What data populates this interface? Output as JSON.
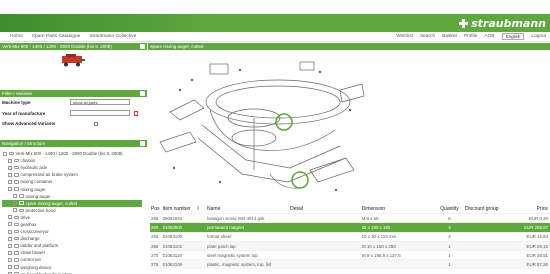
{
  "header": {
    "brand": "straubmann",
    "menu_left": [
      "Home",
      "Spare Parts Catalogue",
      "Strautmann Collective"
    ],
    "menu_right": [
      "Wishlist",
      "Search",
      "Basket",
      "Profile",
      "AGB"
    ],
    "language": "English",
    "logout": "Logout"
  },
  "left_panel": {
    "machine_title": "Verti-Mix 600 - 1400 / 1200 - 2800 Double (bis 8, 2008)",
    "filter_title": "Filter / Variants",
    "machine_type_label": "Machine type",
    "machine_type_value": "show all parts",
    "year_label": "Year of manufacture",
    "year_value": "",
    "advanced_label": "Show Advanced Variants",
    "nav_title": "Navigation / Structure",
    "tree": [
      {
        "label": "Verti-Mix 600 - 1400 / 1200 - 2800 Double (bis 8, 2008)",
        "depth": 0,
        "selected": false
      },
      {
        "label": "chassis",
        "depth": 1,
        "selected": false
      },
      {
        "label": "hydraulic axle",
        "depth": 1,
        "selected": false
      },
      {
        "label": "compressed air brake system",
        "depth": 1,
        "selected": false
      },
      {
        "label": "mixing container",
        "depth": 1,
        "selected": false
      },
      {
        "label": "mixing auger",
        "depth": 1,
        "selected": false
      },
      {
        "label": "mixing auger",
        "depth": 2,
        "selected": false
      },
      {
        "label": "spare mixing auger, cutted",
        "depth": 2,
        "selected": true
      },
      {
        "label": "protective hood",
        "depth": 2,
        "selected": false
      },
      {
        "label": "drive",
        "depth": 1,
        "selected": false
      },
      {
        "label": "gearbox",
        "depth": 1,
        "selected": false
      },
      {
        "label": "crossconveyor",
        "depth": 1,
        "selected": false
      },
      {
        "label": "discharge",
        "depth": 1,
        "selected": false
      },
      {
        "label": "ladder and platform",
        "depth": 1,
        "selected": false
      },
      {
        "label": "straw blower",
        "depth": 1,
        "selected": false
      },
      {
        "label": "control set",
        "depth": 1,
        "selected": false
      },
      {
        "label": "weighing device",
        "depth": 1,
        "selected": false
      },
      {
        "label": "on-board hydraulic system",
        "depth": 1,
        "selected": false
      }
    ]
  },
  "main": {
    "title": "Spare mixing auger, cutted",
    "columns": [
      "Pos",
      "Item number",
      "I",
      "Name",
      "Detail",
      "Dimension",
      "Quantity",
      "Discount group",
      "Price"
    ],
    "rows": [
      {
        "pos": "255",
        "item": "09062022",
        "name": "hexagon screw ISO 4014 gsk",
        "detail": "",
        "dim": "M 8 x 60",
        "qty": "6",
        "disc": "",
        "price": "EUR 0,20"
      },
      {
        "pos": "260",
        "item": "01063000",
        "name": "permanent magnet",
        "detail": "",
        "dim": "25 x 180 x 195",
        "qty": "4",
        "disc": "",
        "price": "EUR 208,87"
      },
      {
        "pos": "265",
        "item": "01063100",
        "name": "format sheet",
        "detail": "",
        "dim": "10 x 30 x 115 mm",
        "qty": "4",
        "disc": "",
        "price": "EUR 15,84"
      },
      {
        "pos": "266",
        "item": "01063101",
        "name": "plate patch lap",
        "detail": "",
        "dim": "St 10 x 160 x 250",
        "qty": "1",
        "disc": "",
        "price": "EUR 26,15"
      },
      {
        "pos": "270",
        "item": "01063110",
        "name": "steel magnetic system top",
        "detail": "",
        "dim": "St 8 x 195,5 x 127,5",
        "qty": "1",
        "disc": "",
        "price": "EUR 48,51"
      },
      {
        "pos": "275",
        "item": "01063105",
        "name": "plastic, magnetic system, top, list",
        "detail": "",
        "dim": "",
        "qty": "1",
        "disc": "",
        "price": "EUR 87,26"
      }
    ]
  }
}
